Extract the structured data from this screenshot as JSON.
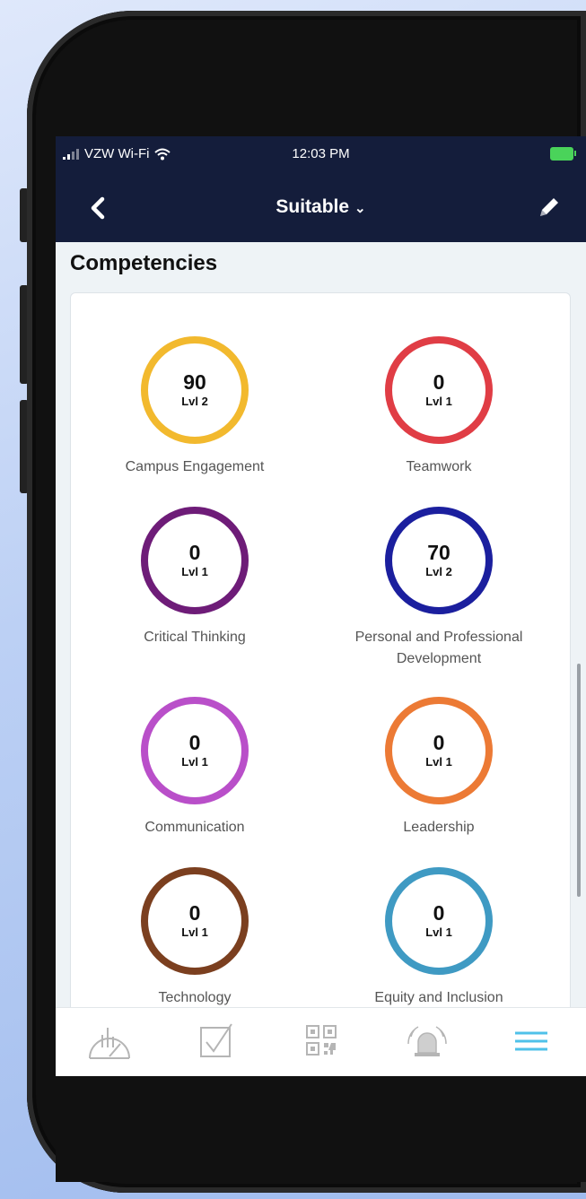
{
  "status": {
    "carrier": "VZW Wi-Fi",
    "time": "12:03 PM"
  },
  "nav": {
    "title": "Suitable"
  },
  "section_title": "Competencies",
  "competencies": [
    {
      "name": "Campus Engagement",
      "score": "90",
      "level": "Lvl 2",
      "color": "#f2b92e"
    },
    {
      "name": "Teamwork",
      "score": "0",
      "level": "Lvl 1",
      "color": "#e03d45"
    },
    {
      "name": "Critical Thinking",
      "score": "0",
      "level": "Lvl 1",
      "color": "#6e1c78"
    },
    {
      "name": "Personal and Professional Development",
      "score": "70",
      "level": "Lvl 2",
      "color": "#1b1f9e"
    },
    {
      "name": "Communication",
      "score": "0",
      "level": "Lvl 1",
      "color": "#b94fc9"
    },
    {
      "name": "Leadership",
      "score": "0",
      "level": "Lvl 1",
      "color": "#ec7a35"
    },
    {
      "name": "Technology",
      "score": "0",
      "level": "Lvl 1",
      "color": "#7b3f1f"
    },
    {
      "name": "Equity and Inclusion",
      "score": "0",
      "level": "Lvl 1",
      "color": "#3f9ac3"
    }
  ],
  "tabs": [
    {
      "icon": "dashboard-gauge-icon"
    },
    {
      "icon": "checkbox-icon"
    },
    {
      "icon": "qr-code-icon"
    },
    {
      "icon": "alarm-bell-icon"
    },
    {
      "icon": "menu-icon",
      "active": true,
      "color": "#4fc1e9"
    }
  ]
}
